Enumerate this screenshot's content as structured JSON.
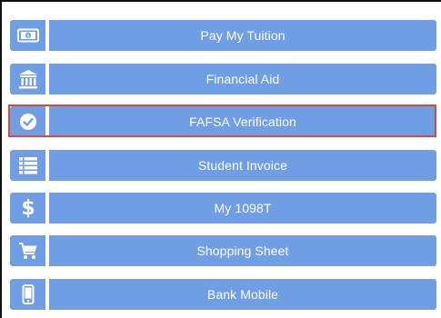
{
  "menu": {
    "items": [
      {
        "label": "Pay My Tuition",
        "icon": "money-bill-icon"
      },
      {
        "label": "Financial Aid",
        "icon": "bank-building-icon"
      },
      {
        "label": "FAFSA Verification",
        "icon": "check-circle-icon",
        "selected": true
      },
      {
        "label": "Student Invoice",
        "icon": "list-icon"
      },
      {
        "label": "My 1098T",
        "icon": "dollar-icon"
      },
      {
        "label": "Shopping Sheet",
        "icon": "shopping-cart-icon"
      },
      {
        "label": "Bank Mobile",
        "icon": "mobile-phone-icon"
      }
    ]
  },
  "colors": {
    "button_blue": "#6f9ee4",
    "highlight_red": "#d9473f",
    "text": "#ffffff"
  }
}
